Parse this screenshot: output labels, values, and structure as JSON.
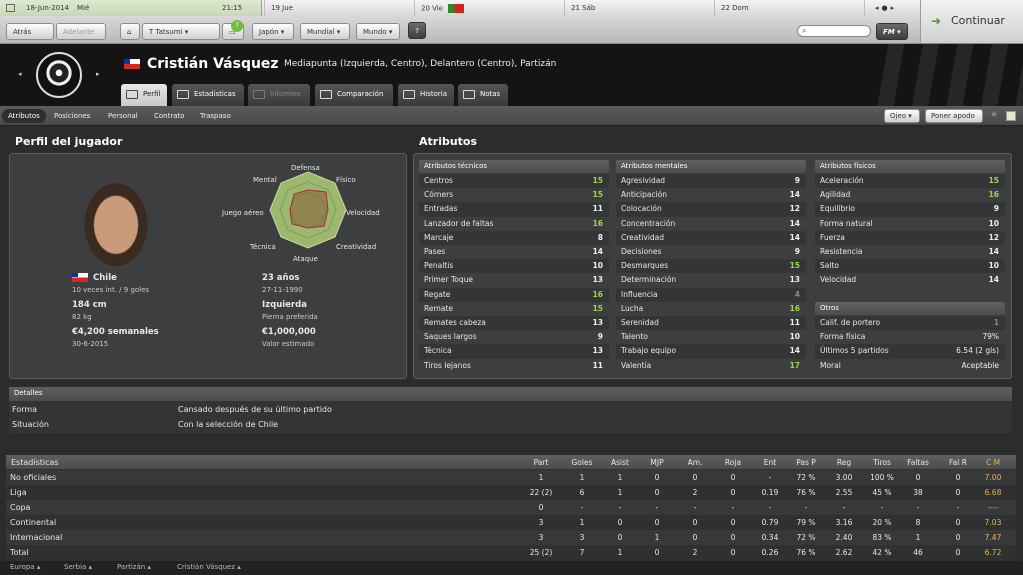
{
  "calendar": {
    "date": "18-Jun-2014",
    "weekday": "Mié",
    "time": "21:15",
    "days": [
      {
        "num": "19",
        "name": "Jue"
      },
      {
        "num": "20",
        "name": "Vie"
      },
      {
        "num": "21",
        "name": "Sáb"
      },
      {
        "num": "22",
        "name": "Dom"
      }
    ]
  },
  "toolbar": {
    "back": "Atrás",
    "forward": "Adelante",
    "manager": "T Tatsumi",
    "japan": "Japón",
    "world_cup": "Mundial",
    "world": "Mundo",
    "help": "?",
    "badge": "7",
    "fm": "FM",
    "continue": "Continuar"
  },
  "player": {
    "name": "Cristián Vásquez",
    "positions": "Mediapunta (Izquierda, Centro), Delantero (Centro), Partizán"
  },
  "tabs": [
    "Perfil",
    "Estadísticas",
    "Informes",
    "Comparación",
    "Historia",
    "Notas"
  ],
  "subnav": {
    "items": [
      "Atributos",
      "Posiciones",
      "Personal",
      "Contrato",
      "Traspaso"
    ],
    "eye": "Ojeo",
    "nickname": "Poner apodo"
  },
  "profile": {
    "title": "Perfil del jugador",
    "radar": [
      "Defensa",
      "Físico",
      "Velocidad",
      "Creatividad",
      "Ataque",
      "Técnica",
      "Juego aéreo",
      "Mental"
    ],
    "nation": "Chile",
    "caps": "10 veces int. / 9 goles",
    "age": "23 años",
    "dob": "27-11-1990",
    "height": "184 cm",
    "weight": "82 kg",
    "foot": "Izquierda",
    "foot_label": "Pierna preferida",
    "wage": "€4,200 semanales",
    "contract": "30-6-2015",
    "value": "€1,000,000",
    "value_label": "Valor estimado"
  },
  "attrs": {
    "title": "Atributos",
    "technical": {
      "head": "Atributos técnicos",
      "rows": [
        [
          "Centros",
          "15"
        ],
        [
          "Córners",
          "15"
        ],
        [
          "Entradas",
          "11"
        ],
        [
          "Lanzador de faltas",
          "16"
        ],
        [
          "Marcaje",
          "8"
        ],
        [
          "Pases",
          "14"
        ],
        [
          "Penaltis",
          "10"
        ],
        [
          "Primer Toque",
          "13"
        ],
        [
          "Regate",
          "16"
        ],
        [
          "Remate",
          "15"
        ],
        [
          "Remates cabeza",
          "13"
        ],
        [
          "Saques largos",
          "9"
        ],
        [
          "Técnica",
          "13"
        ],
        [
          "Tiros lejanos",
          "11"
        ]
      ]
    },
    "mental": {
      "head": "Atributos mentales",
      "rows": [
        [
          "Agresividad",
          "9"
        ],
        [
          "Anticipación",
          "14"
        ],
        [
          "Colocación",
          "12"
        ],
        [
          "Concentración",
          "14"
        ],
        [
          "Creatividad",
          "14"
        ],
        [
          "Decisiones",
          "9"
        ],
        [
          "Desmarques",
          "15"
        ],
        [
          "Determinación",
          "13"
        ],
        [
          "Influencia",
          "4"
        ],
        [
          "Lucha",
          "16"
        ],
        [
          "Serenidad",
          "11"
        ],
        [
          "Talento",
          "10"
        ],
        [
          "Trabajo equipo",
          "14"
        ],
        [
          "Valentía",
          "17"
        ]
      ]
    },
    "physical": {
      "head": "Atributos físicos",
      "rows": [
        [
          "Aceleración",
          "15"
        ],
        [
          "Agilidad",
          "16"
        ],
        [
          "Equilibrio",
          "9"
        ],
        [
          "Forma natural",
          "10"
        ],
        [
          "Fuerza",
          "12"
        ],
        [
          "Resistencia",
          "14"
        ],
        [
          "Salto",
          "10"
        ],
        [
          "Velocidad",
          "14"
        ]
      ]
    },
    "other": {
      "head": "Otros",
      "rows": [
        [
          "Calif. de portero",
          "1"
        ],
        [
          "Forma física",
          "79%"
        ],
        [
          "Últimos 5 partidos",
          "6.54 (2 gls)"
        ],
        [
          "Moral",
          "Aceptable"
        ]
      ]
    }
  },
  "details": {
    "head": "Detalles",
    "rows": [
      [
        "Forma",
        "Cansado después de su último partido"
      ],
      [
        "Situación",
        "Con la selección de Chile"
      ]
    ]
  },
  "stats": {
    "head": "Estadísticas",
    "cols": [
      "Part",
      "Goles",
      "Asist",
      "MJP",
      "Am.",
      "Roja",
      "Ent",
      "Pas P",
      "Reg",
      "Tiros",
      "Faltas",
      "Fal R",
      "C M"
    ],
    "rows": [
      [
        "No oficiales",
        "1",
        "1",
        "1",
        "0",
        "0",
        "0",
        "-",
        "72 %",
        "3.00",
        "100 %",
        "0",
        "0",
        "7.00"
      ],
      [
        "Liga",
        "22 (2)",
        "6",
        "1",
        "0",
        "2",
        "0",
        "0.19",
        "76 %",
        "2.55",
        "45 %",
        "38",
        "0",
        "6.68"
      ],
      [
        "Copa",
        "0",
        "-",
        "-",
        "-",
        "-",
        "-",
        "-",
        "-",
        "-",
        "-",
        "-",
        "-",
        "----"
      ],
      [
        "Continental",
        "3",
        "1",
        "0",
        "0",
        "0",
        "0",
        "0.79",
        "79 %",
        "3.16",
        "20 %",
        "8",
        "0",
        "7.03"
      ],
      [
        "Internacional",
        "3",
        "3",
        "0",
        "1",
        "0",
        "0",
        "0.34",
        "72 %",
        "2.40",
        "83 %",
        "1",
        "0",
        "7.47"
      ],
      [
        "Total",
        "25 (2)",
        "7",
        "1",
        "0",
        "2",
        "0",
        "0.26",
        "76 %",
        "2.62",
        "42 %",
        "46",
        "0",
        "6.72"
      ]
    ]
  },
  "footer": [
    "Europa",
    "Serbia",
    "Partizán",
    "Cristián Vásquez"
  ]
}
